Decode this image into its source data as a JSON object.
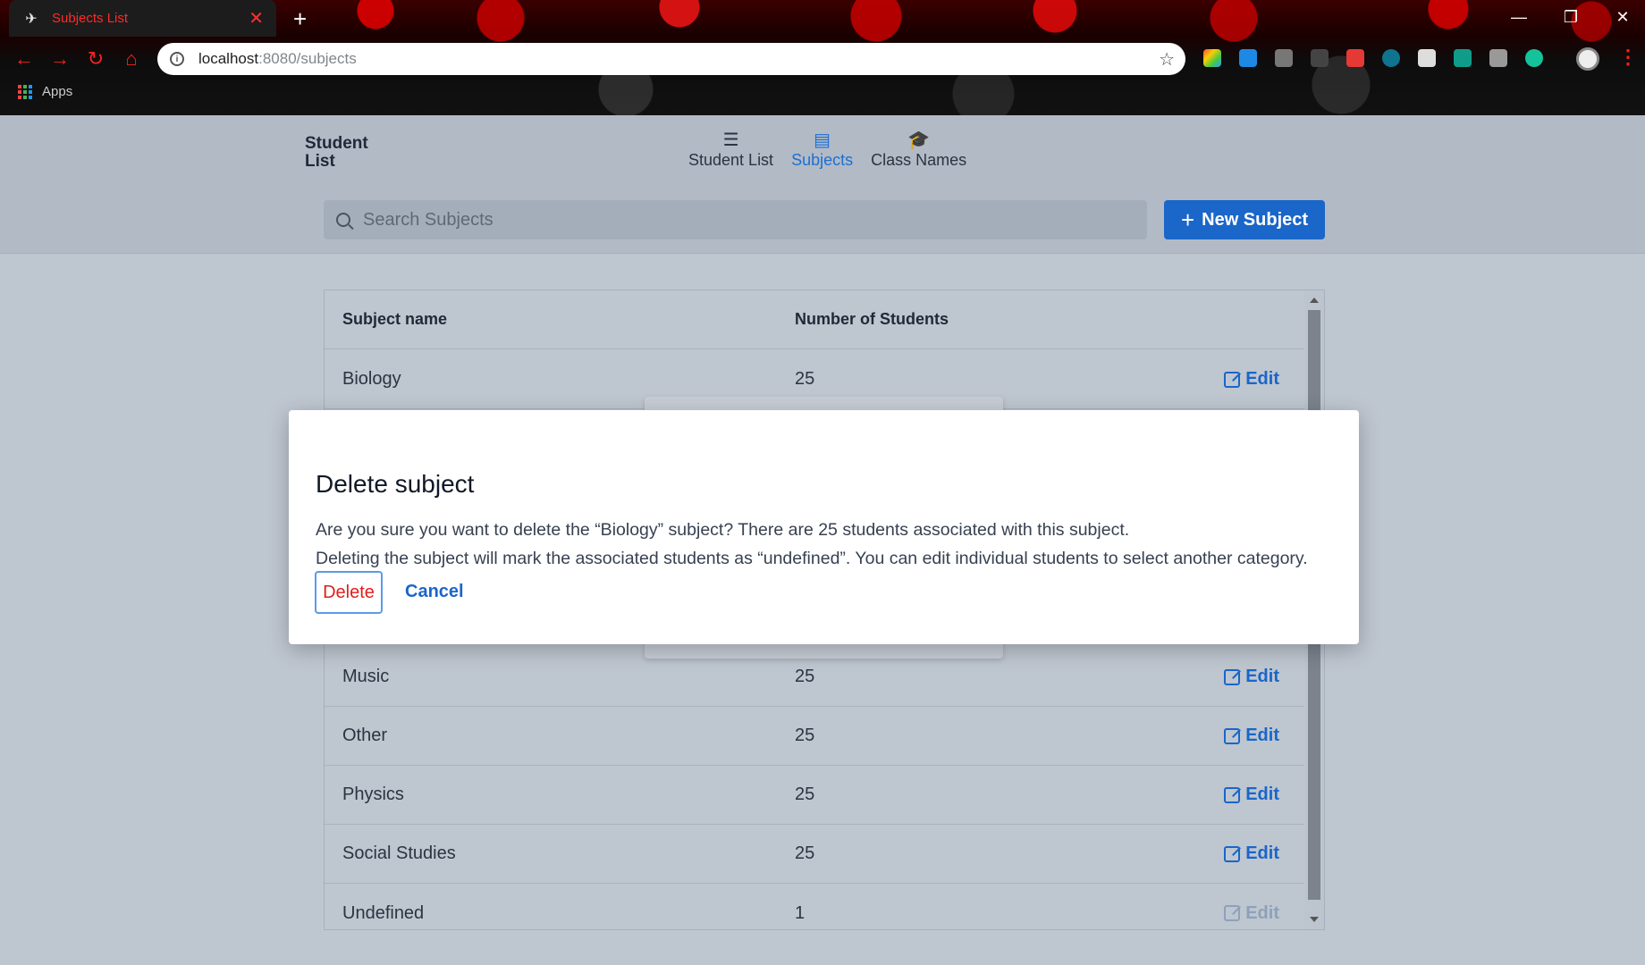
{
  "browser": {
    "tab_title": "Subjects List",
    "url_host": "localhost",
    "url_rest": ":8080/subjects",
    "bookmarks_label": "Apps"
  },
  "app": {
    "brand": "Student List",
    "nav": [
      {
        "label": "Student List",
        "icon": "list-icon",
        "active": false
      },
      {
        "label": "Subjects",
        "icon": "book-icon",
        "active": true
      },
      {
        "label": "Class Names",
        "icon": "graduation-cap-icon",
        "active": false
      }
    ],
    "search_placeholder": "Search Subjects",
    "new_subject_label": "New Subject"
  },
  "table": {
    "headers": [
      "Subject name",
      "Number of Students"
    ],
    "rows": [
      {
        "name": "Biology",
        "count": "25",
        "action": "Edit",
        "enabled": true
      },
      {
        "name": "Music",
        "count": "25",
        "action": "Edit",
        "enabled": true
      },
      {
        "name": "Other",
        "count": "25",
        "action": "Edit",
        "enabled": true
      },
      {
        "name": "Physics",
        "count": "25",
        "action": "Edit",
        "enabled": true
      },
      {
        "name": "Social Studies",
        "count": "25",
        "action": "Edit",
        "enabled": true
      },
      {
        "name": "Undefined",
        "count": "1",
        "action": "Edit",
        "enabled": false
      }
    ]
  },
  "modal": {
    "title": "Delete subject",
    "line1": "Are you sure you want to delete the “Biology” subject? There are 25 students associated with this subject.",
    "line2": "Deleting the subject will mark the associated students as “undefined”. You can edit individual students to select another category.",
    "delete_label": "Delete",
    "cancel_label": "Cancel"
  },
  "colors": {
    "accent": "#1a66c9",
    "danger": "#e11d1d"
  }
}
